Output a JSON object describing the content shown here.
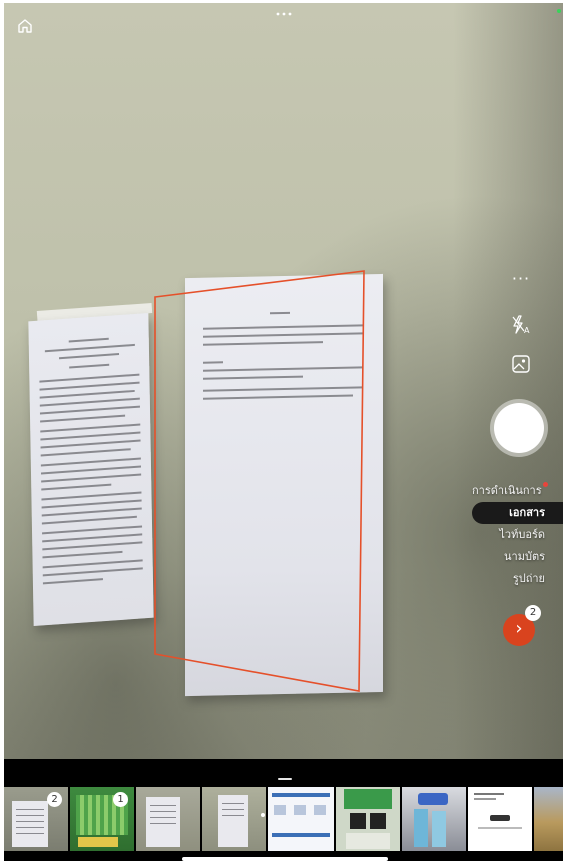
{
  "app": {
    "top_more_icon": "more-horizontal-icon",
    "home_icon": "home-icon"
  },
  "capture_modes": [
    {
      "label": "การดำเนินการ",
      "active": false,
      "has_notification": true
    },
    {
      "label": "เอกสาร",
      "active": true,
      "has_notification": false
    },
    {
      "label": "ไวท์บอร์ด",
      "active": false,
      "has_notification": false
    },
    {
      "label": "นามบัตร",
      "active": false,
      "has_notification": false
    },
    {
      "label": "รูปถ่าย",
      "active": false,
      "has_notification": false
    }
  ],
  "controls": {
    "more_label": "···",
    "flash_icon": "flash-auto-icon",
    "gallery_icon": "image-import-icon",
    "shutter_icon": "shutter-button",
    "next_label": "›",
    "next_badge": "2"
  },
  "thumbnails": [
    {
      "badge": "2",
      "kind": "document"
    },
    {
      "badge": "1",
      "kind": "poster-green"
    },
    {
      "badge": "",
      "kind": "document"
    },
    {
      "badge": "",
      "kind": "document"
    },
    {
      "badge": "",
      "kind": "screen"
    },
    {
      "badge": "",
      "kind": "poster-qr"
    },
    {
      "badge": "",
      "kind": "bottles"
    },
    {
      "badge": "",
      "kind": "document-white"
    },
    {
      "badge": "",
      "kind": "field"
    }
  ],
  "colors": {
    "accent": "#d9431e",
    "frame": "#e5502a",
    "notification": "#e9443b"
  }
}
